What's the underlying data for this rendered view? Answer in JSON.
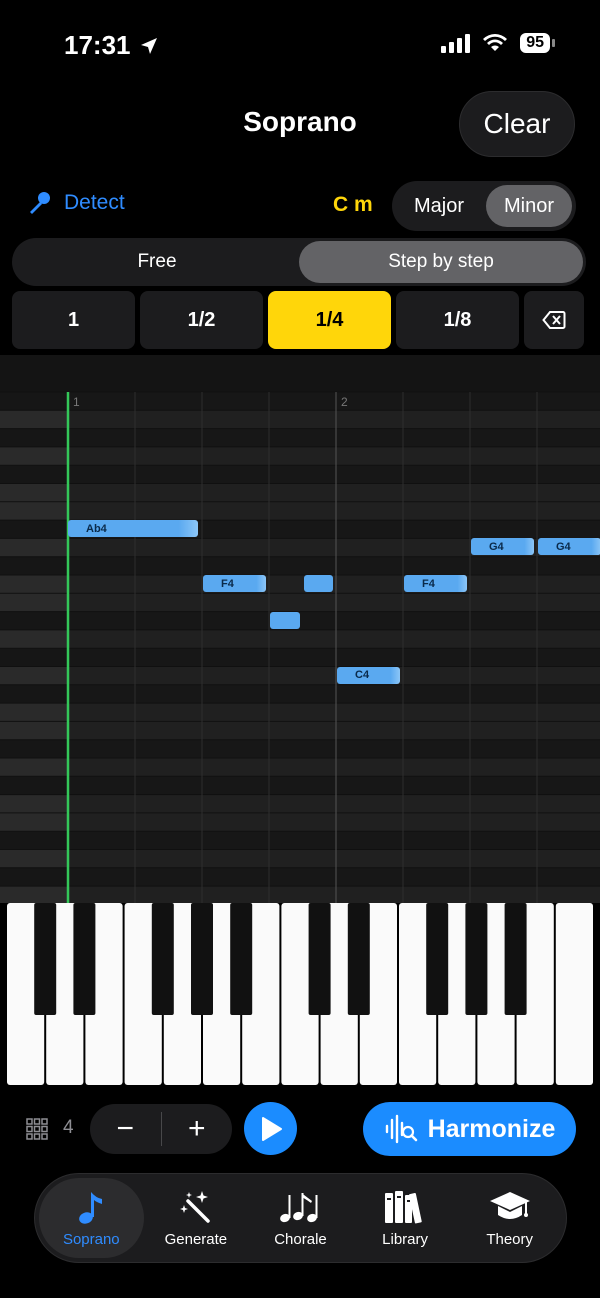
{
  "status": {
    "time": "17:31",
    "battery": "95"
  },
  "header": {
    "title": "Soprano",
    "clear_label": "Clear"
  },
  "key": {
    "detect_label": "Detect",
    "name": "C m",
    "modes": [
      "Major",
      "Minor"
    ],
    "active_mode": "Minor"
  },
  "input_modes": {
    "items": [
      "Free",
      "Step by step"
    ],
    "active": "Step by step"
  },
  "durations": {
    "items": [
      "1",
      "1/2",
      "1/4",
      "1/8"
    ],
    "active": "1/4"
  },
  "roll": {
    "bar_labels": [
      "1",
      "2"
    ],
    "notes": [
      {
        "label": "Ab4",
        "beat": 0,
        "length": 2,
        "row": 7
      },
      {
        "label": "F4",
        "beat": 2,
        "length": 1,
        "row": 10
      },
      {
        "label": "",
        "beat": 3,
        "length": 0.5,
        "row": 12
      },
      {
        "label": "",
        "beat": 3.5,
        "length": 0.5,
        "row": 10
      },
      {
        "label": "C4",
        "beat": 4,
        "length": 1,
        "row": 15
      },
      {
        "label": "F4",
        "beat": 5,
        "length": 1,
        "row": 10
      },
      {
        "label": "G4",
        "beat": 6,
        "length": 1,
        "row": 8
      },
      {
        "label": "G4",
        "beat": 7,
        "length": 1,
        "row": 8
      }
    ]
  },
  "controls": {
    "beats_per_bar": "4",
    "minus": "−",
    "plus": "+",
    "harmonize_label": "Harmonize"
  },
  "tabs": [
    {
      "label": "Soprano",
      "icon": "music-note-icon",
      "active": true
    },
    {
      "label": "Generate",
      "icon": "magic-wand-icon",
      "active": false
    },
    {
      "label": "Chorale",
      "icon": "music-notes-icon",
      "active": false
    },
    {
      "label": "Library",
      "icon": "books-icon",
      "active": false
    },
    {
      "label": "Theory",
      "icon": "graduation-cap-icon",
      "active": false
    }
  ],
  "colors": {
    "accent": "#1b8cff",
    "key_color": "#ffd60a",
    "note": "#5aa9f0",
    "playhead": "#34c759"
  }
}
